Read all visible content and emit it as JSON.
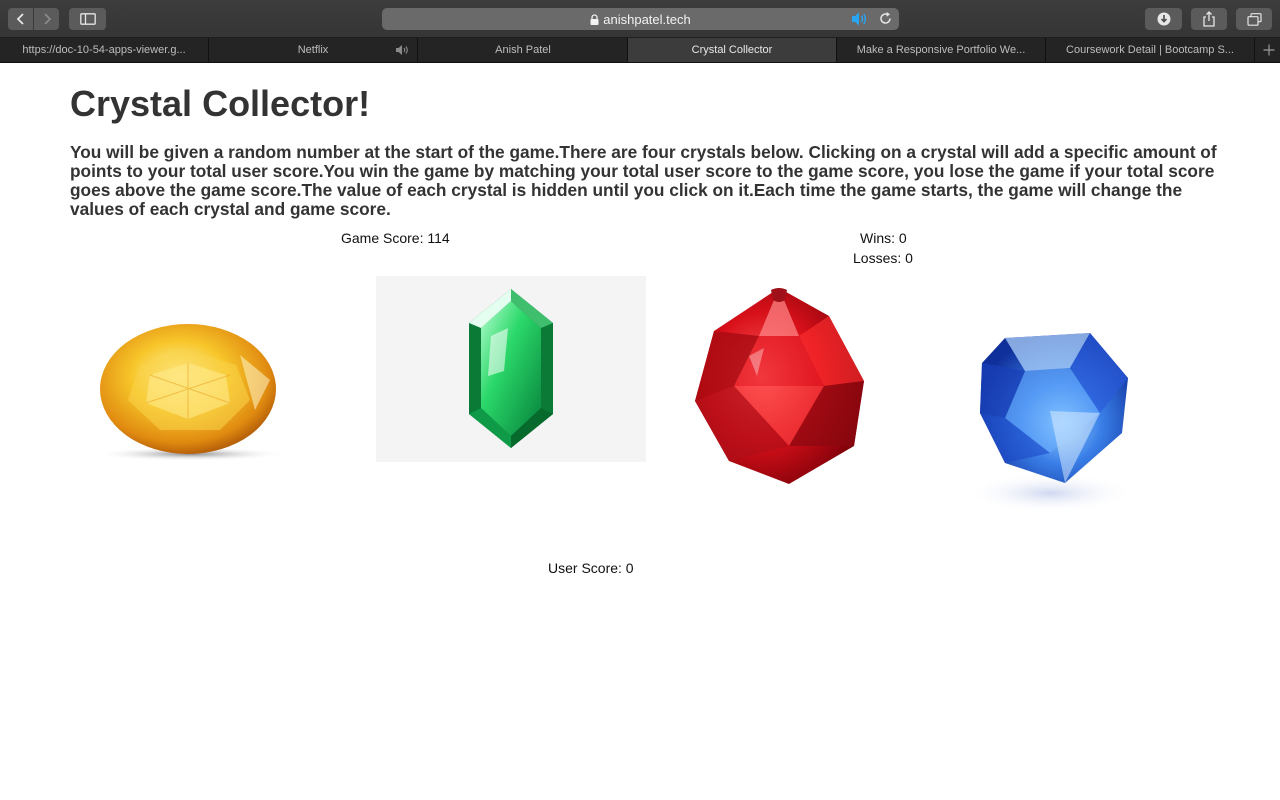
{
  "browser": {
    "address_url": "anishpatel.tech",
    "tabs": [
      {
        "label": "https://doc-10-54-apps-viewer.g..."
      },
      {
        "label": "Netflix"
      },
      {
        "label": "Anish Patel"
      },
      {
        "label": "Crystal Collector"
      },
      {
        "label": "Make a Responsive Portfolio We..."
      },
      {
        "label": "Coursework Detail | Bootcamp S..."
      }
    ],
    "active_tab": "Crystal Collector",
    "accent_color": "#2aa4f4"
  },
  "page": {
    "title": "Crystal Collector!",
    "instructions": "You will be given a random number at the start of the game.There are four crystals below. Clicking on a crystal will add a specific amount of points to your total user score.You win the game by matching your total user score to the game score, you lose the game if your total score goes above the game score.The value of each crystal is hidden until you click on it.Each time the game starts, the game will change the values of each crystal and game score.",
    "game_score_text": "Game Score: 114",
    "wins_text": "Wins: 0",
    "losses_text": "Losses: 0",
    "user_score_text": "User Score: 0"
  },
  "crystals": [
    {
      "name": "yellow-sapphire",
      "color": "#f2a81c"
    },
    {
      "name": "green-emerald",
      "color": "#17b45a"
    },
    {
      "name": "red-ruby",
      "color": "#c8101a"
    },
    {
      "name": "blue-diamond",
      "color": "#2a62d8"
    }
  ]
}
